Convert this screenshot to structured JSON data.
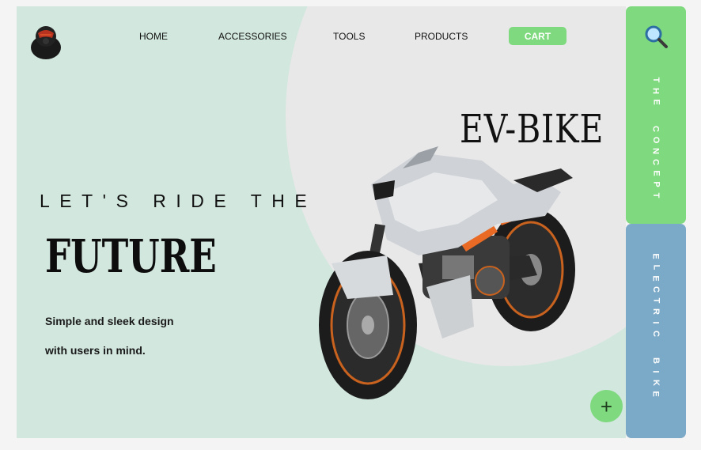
{
  "nav": {
    "items": [
      "HOME",
      "ACCESSORIES",
      "TOOLS",
      "PRODUCTS"
    ],
    "cart_label": "CART"
  },
  "hero": {
    "brand_title": "EV-BIKE",
    "kicker": "LET'S RIDE THE",
    "headline": "FUTURE",
    "tagline_line1": "Simple and sleek design",
    "tagline_line2": "with users in mind."
  },
  "sidebar": {
    "search_icon": "search-icon",
    "concept_label": "THE CONCEPT",
    "electric_label": "ELECTRIC BIKE"
  },
  "actions": {
    "plus_label": "+"
  },
  "colors": {
    "background": "#d2e7de",
    "blob": "#e8e8e8",
    "accent_green": "#7fd97f",
    "accent_blue": "#7ba9c8",
    "text_dark": "#111111"
  }
}
